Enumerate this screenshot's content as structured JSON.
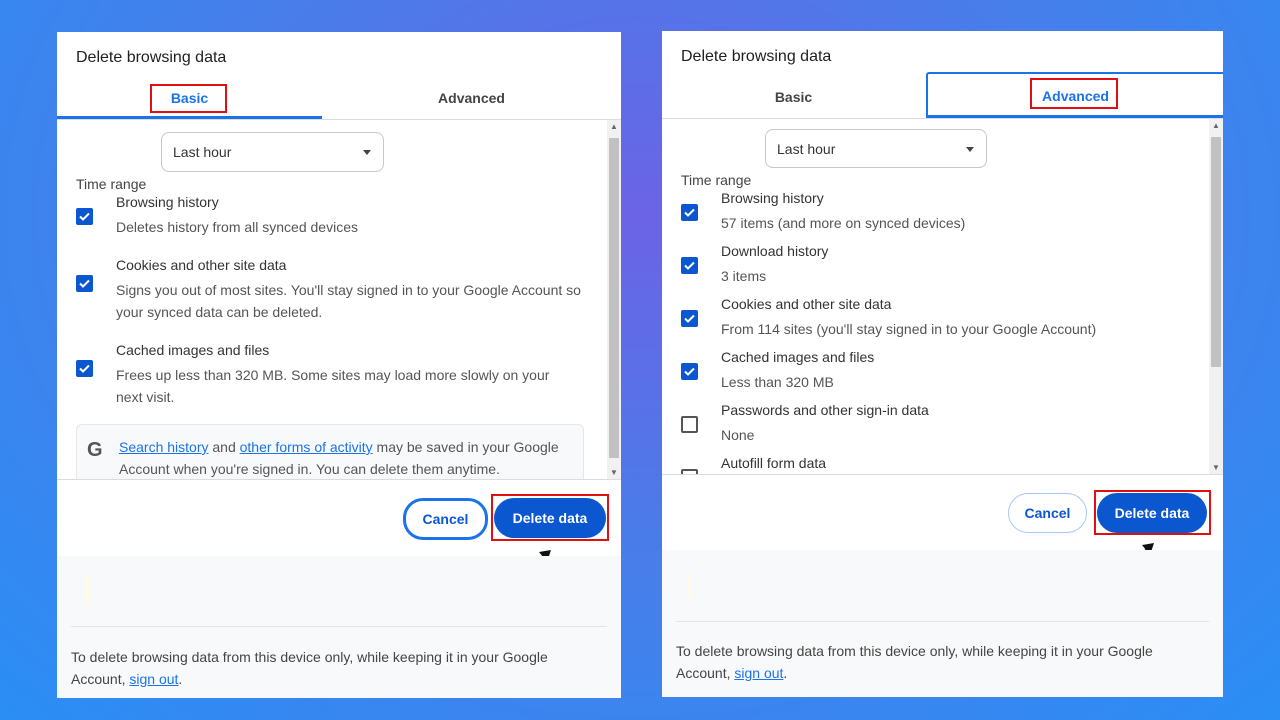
{
  "panels": [
    {
      "title": "Delete browsing data",
      "tabs": [
        "Basic",
        "Advanced"
      ],
      "active_tab": "Basic",
      "time_range_label": "Time range",
      "time_range_value": "Last hour",
      "items": [
        {
          "title": "Browsing history",
          "desc": "Deletes history from all synced devices",
          "checked": true
        },
        {
          "title": "Cookies and other site data",
          "desc": "Signs you out of most sites. You'll stay signed in to your Google Account so your synced data can be deleted.",
          "checked": true
        },
        {
          "title": "Cached images and files",
          "desc": "Frees up less than 320 MB. Some sites may load more slowly on your next visit.",
          "checked": true
        }
      ],
      "info": {
        "link1": "Search history",
        "and": " and ",
        "link2": "other forms of activity",
        "rest": " may be saved in your Google Account when you're signed in. You can delete them anytime."
      },
      "cancel": "Cancel",
      "delete": "Delete data",
      "footer_text": "To delete browsing data from this device only, while keeping it in your Google Account, ",
      "footer_link": "sign out",
      "footer_end": "."
    },
    {
      "title": "Delete browsing data",
      "tabs": [
        "Basic",
        "Advanced"
      ],
      "active_tab": "Advanced",
      "time_range_label": "Time range",
      "time_range_value": "Last hour",
      "items": [
        {
          "title": "Browsing history",
          "desc": "57 items (and more on synced devices)",
          "checked": true
        },
        {
          "title": "Download history",
          "desc": "3 items",
          "checked": true
        },
        {
          "title": "Cookies and other site data",
          "desc": "From 114 sites (you'll stay signed in to your Google Account)",
          "checked": true
        },
        {
          "title": "Cached images and files",
          "desc": "Less than 320 MB",
          "checked": true
        },
        {
          "title": "Passwords and other sign-in data",
          "desc": "None",
          "checked": false
        },
        {
          "title": "Autofill form data",
          "desc": "",
          "checked": false
        }
      ],
      "cancel": "Cancel",
      "delete": "Delete data",
      "footer_text": "To delete browsing data from this device only, while keeping it in your Google Account, ",
      "footer_link": "sign out",
      "footer_end": "."
    }
  ],
  "colors": {
    "accent": "#0b57d0",
    "highlight": "#e01010"
  }
}
